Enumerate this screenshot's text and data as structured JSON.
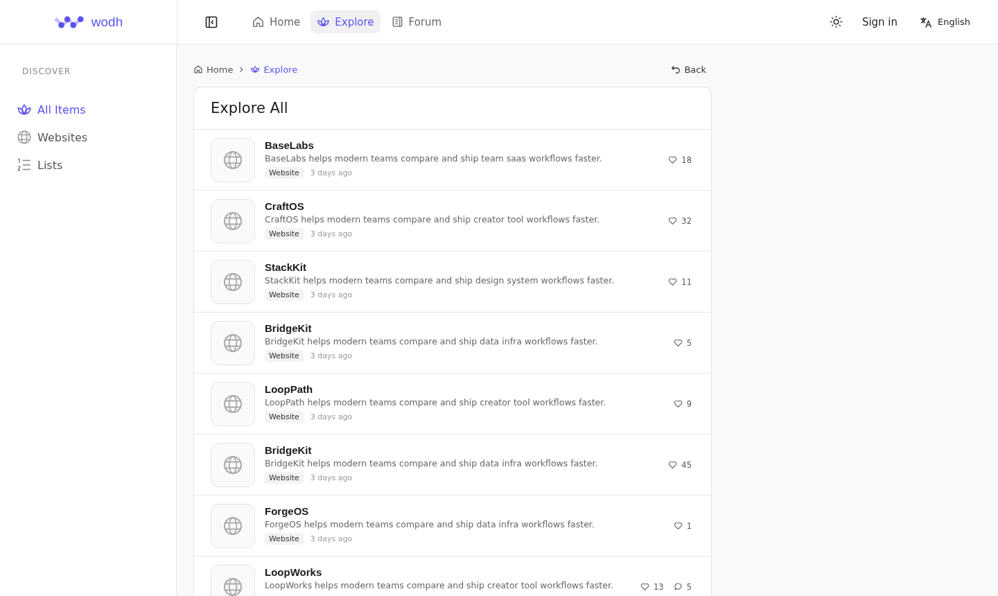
{
  "brand": "wodh",
  "nav": [
    {
      "label": "Home",
      "selected": false
    },
    {
      "label": "Explore",
      "selected": true
    },
    {
      "label": "Forum",
      "selected": false
    }
  ],
  "header_actions": {
    "sign_in": "Sign in",
    "language": "English"
  },
  "sidebar": {
    "heading": "DISCOVER",
    "items": [
      {
        "label": "All Items",
        "selected": true
      },
      {
        "label": "Websites",
        "selected": false
      },
      {
        "label": "Lists",
        "selected": false
      }
    ]
  },
  "breadcrumb": [
    {
      "label": "Home",
      "current": false
    },
    {
      "label": "Explore",
      "current": true
    }
  ],
  "back": "Back",
  "card": {
    "title": "Explore All",
    "items": [
      {
        "name": "BaseLabs",
        "description": "BaseLabs helps modern teams compare and ship team saas workflows faster.",
        "tag": "Website",
        "time": "3 days ago",
        "likes": "18"
      },
      {
        "name": "CraftOS",
        "description": "CraftOS helps modern teams compare and ship creator tool workflows faster.",
        "tag": "Website",
        "time": "3 days ago",
        "likes": "32"
      },
      {
        "name": "StackKit",
        "description": "StackKit helps modern teams compare and ship design system workflows faster.",
        "tag": "Website",
        "time": "3 days ago",
        "likes": "11"
      },
      {
        "name": "BridgeKit",
        "description": "BridgeKit helps modern teams compare and ship data infra workflows faster.",
        "tag": "Website",
        "time": "3 days ago",
        "likes": "5"
      },
      {
        "name": "LoopPath",
        "description": "LoopPath helps modern teams compare and ship creator tool workflows faster.",
        "tag": "Website",
        "time": "3 days ago",
        "likes": "9"
      },
      {
        "name": "BridgeKit",
        "description": "BridgeKit helps modern teams compare and ship data infra workflows faster.",
        "tag": "Website",
        "time": "3 days ago",
        "likes": "45"
      },
      {
        "name": "ForgeOS",
        "description": "ForgeOS helps modern teams compare and ship data infra workflows faster.",
        "tag": "Website",
        "time": "3 days ago",
        "likes": "1"
      },
      {
        "name": "LoopWorks",
        "description": "LoopWorks helps modern teams compare and ship creator tool workflows faster.",
        "likes": "13",
        "comments": "5"
      }
    ]
  }
}
